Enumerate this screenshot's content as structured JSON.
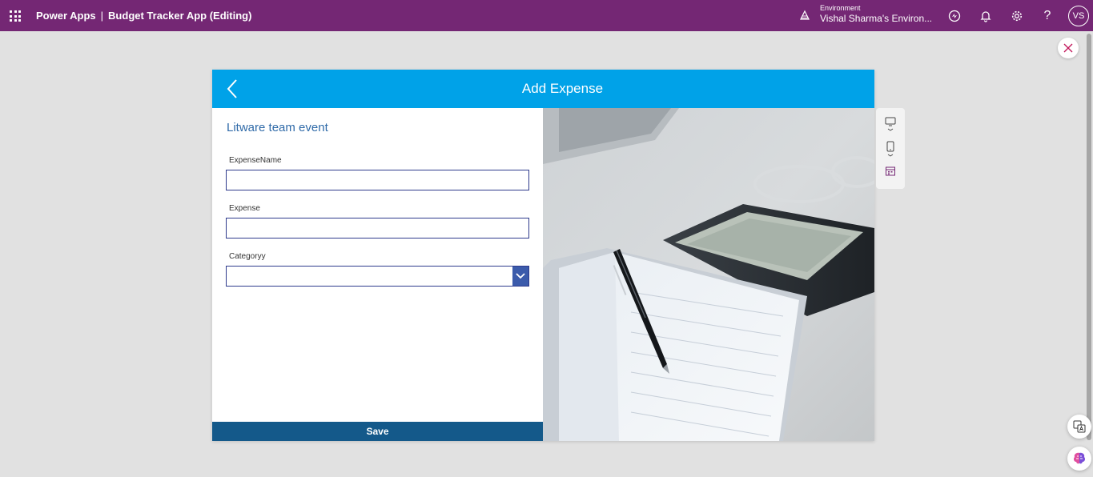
{
  "topbar": {
    "product": "Power Apps",
    "separator": "|",
    "app_title": "Budget Tracker App (Editing)",
    "environment_label": "Environment",
    "environment_value": "Vishal Sharma's Environ...",
    "avatar_initials": "VS",
    "background_color": "#742774"
  },
  "app": {
    "screen_title": "Add Expense",
    "header_color": "#00a2e8",
    "event_name": "Litware team event",
    "fields": {
      "expense_name_label": "ExpenseName",
      "expense_name_value": "",
      "expense_label": "Expense",
      "expense_value": "",
      "category_label": "Categoryy",
      "category_value": ""
    },
    "save_label": "Save",
    "save_color": "#14598a"
  },
  "icons": {
    "waffle": "waffle-icon",
    "environment": "environment-icon",
    "copilot": "copilot-icon",
    "notifications": "bell-icon",
    "settings": "gear-icon",
    "help": "help-icon",
    "close": "close-icon",
    "back": "chevron-left-icon",
    "dropdown": "chevron-down-icon",
    "preview_desktop": "desktop-icon",
    "preview_phone": "phone-icon",
    "preview_calendar": "calendar-icon",
    "translate": "translate-icon",
    "brain": "brain-icon"
  }
}
